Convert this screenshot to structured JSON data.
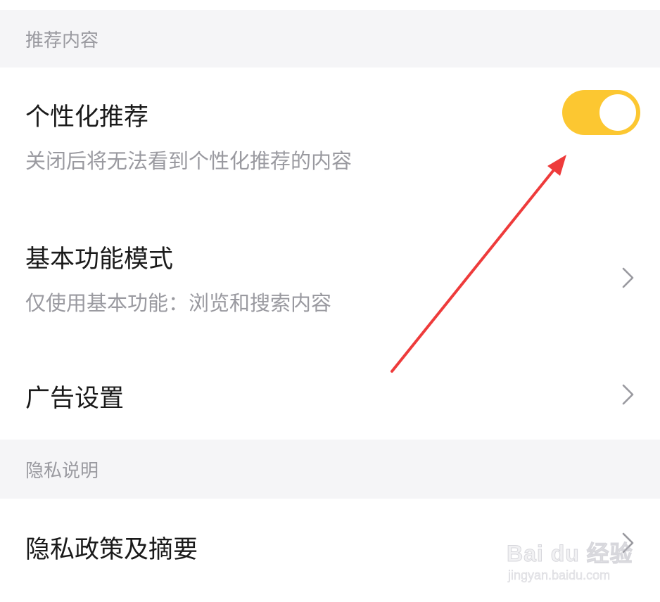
{
  "sections": {
    "recommend_header": "推荐内容",
    "privacy_header": "隐私说明"
  },
  "rows": {
    "personalized": {
      "title": "个性化推荐",
      "subtitle": "关闭后将无法看到个性化推荐的内容",
      "toggle_on": true
    },
    "basic_mode": {
      "title": "基本功能模式",
      "subtitle": "仅使用基本功能：浏览和搜索内容"
    },
    "ad_settings": {
      "title": "广告设置"
    },
    "privacy_policy": {
      "title": "隐私政策及摘要"
    }
  },
  "colors": {
    "toggle_on": "#fcc731",
    "annotation_arrow": "#ee3b3b"
  },
  "icons": {
    "chevron": "chevron-right-icon",
    "annotation": "red-arrow"
  },
  "watermark": {
    "brand": "Bai du 经验",
    "url": "jingyan.baidu.com"
  }
}
